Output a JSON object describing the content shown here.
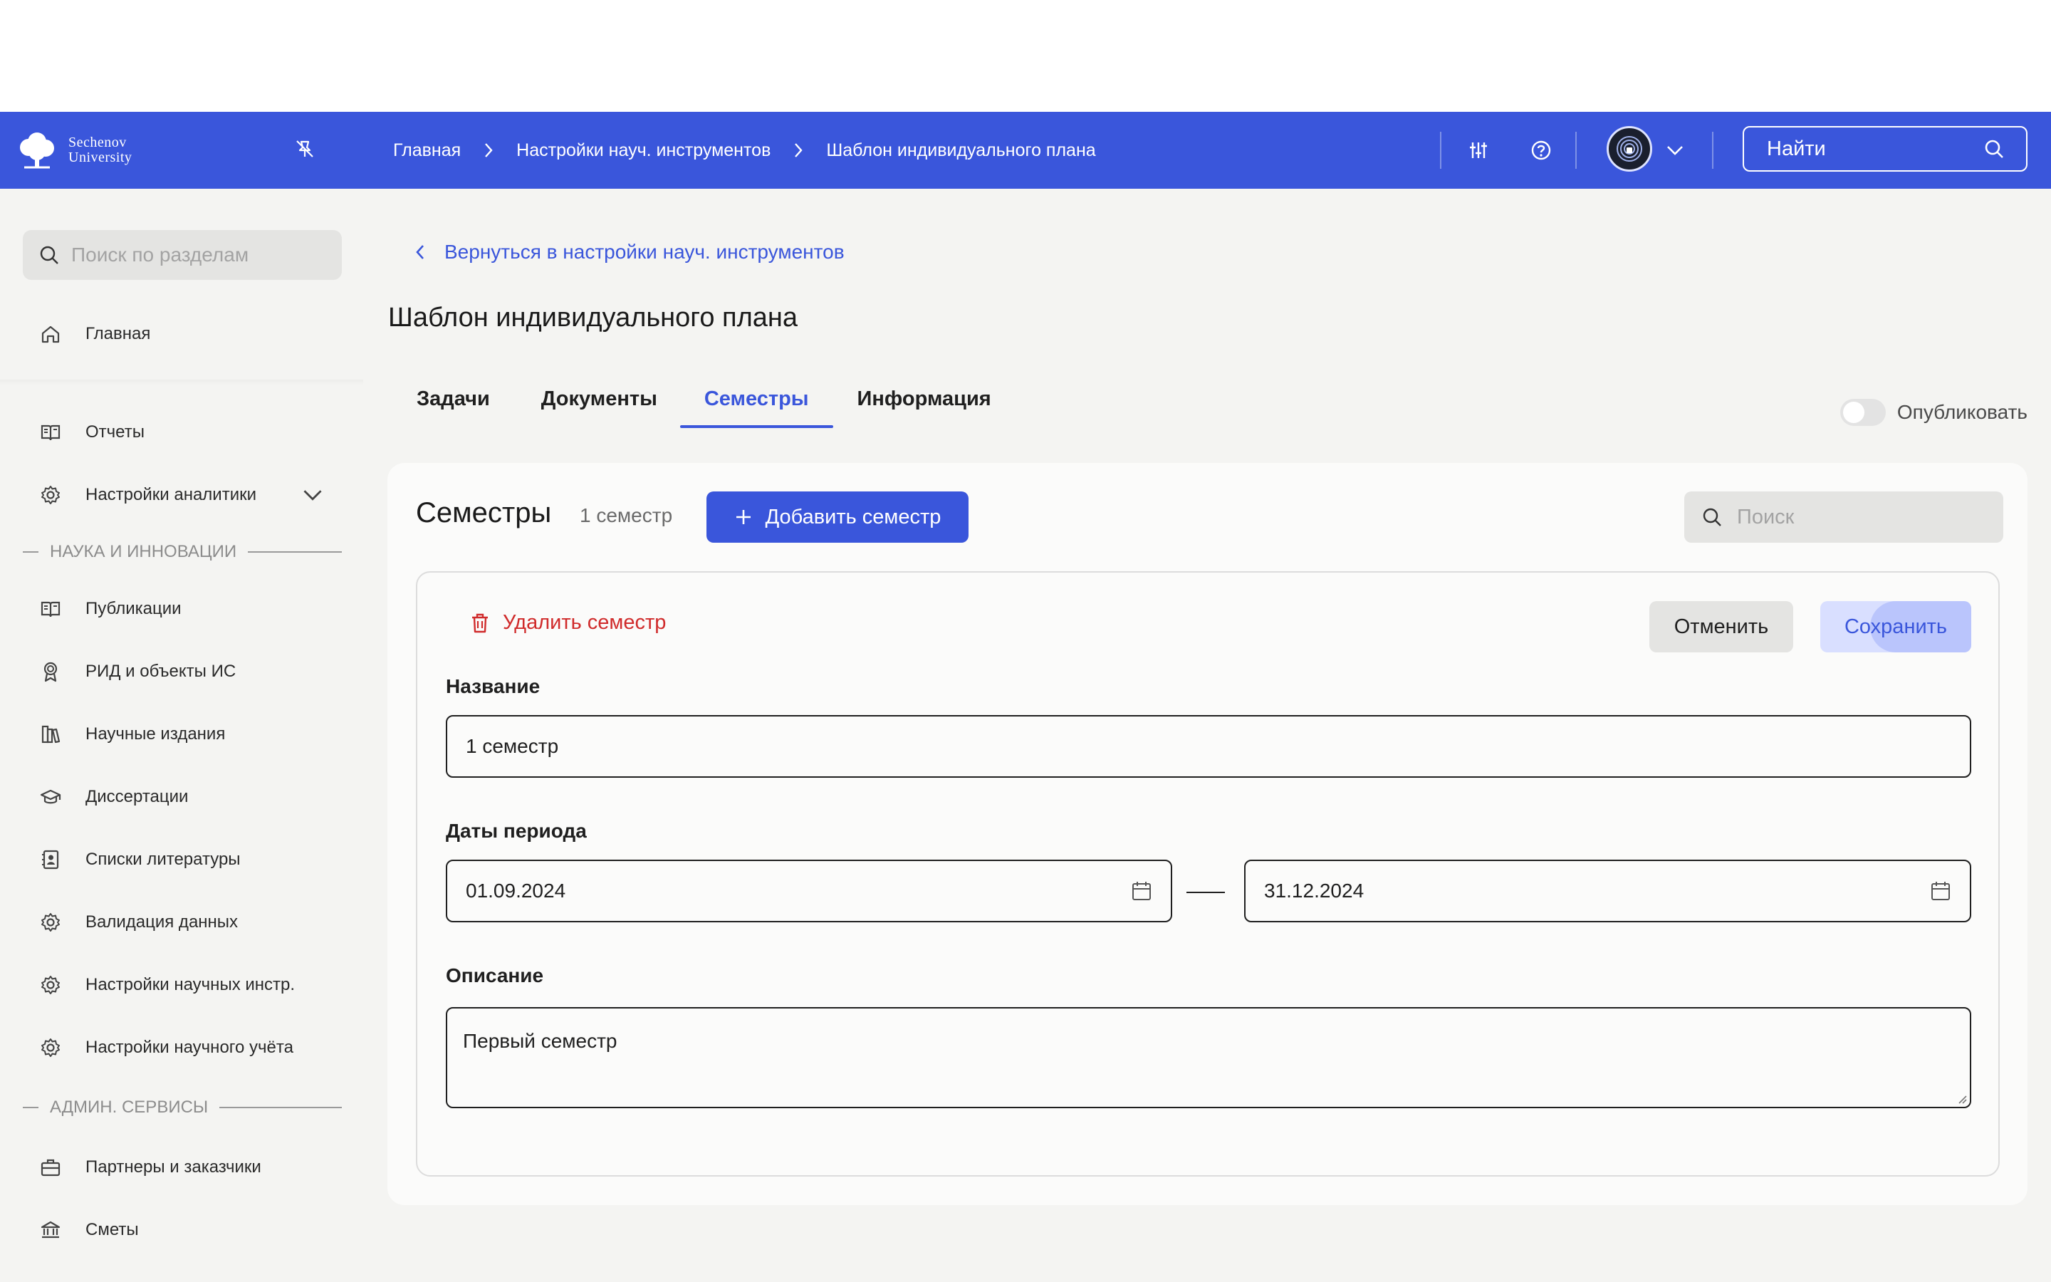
{
  "header": {
    "logo_line1": "Sechenov",
    "logo_line2": "University",
    "breadcrumbs": [
      "Главная",
      "Настройки науч. инструментов",
      "Шаблон индивидуального плана"
    ],
    "search_label": "Найти"
  },
  "sidebar": {
    "search_placeholder": "Поиск по разделам",
    "items_top": [
      {
        "label": "Главная",
        "icon": "home-icon"
      },
      {
        "label": "Отчеты",
        "icon": "book-icon"
      },
      {
        "label": "Настройки аналитики",
        "icon": "gear-icon"
      }
    ],
    "section_science": "НАУКА И ИННОВАЦИИ",
    "items_science": [
      {
        "label": "Публикации",
        "icon": "book-icon"
      },
      {
        "label": "РИД и объекты ИС",
        "icon": "award-icon"
      },
      {
        "label": "Научные издания",
        "icon": "library-icon"
      },
      {
        "label": "Диссертации",
        "icon": "graduation-cap-icon"
      },
      {
        "label": "Списки литературы",
        "icon": "contact-book-icon"
      },
      {
        "label": "Валидация данных",
        "icon": "gear-icon"
      },
      {
        "label": "Настройки научных инстр.",
        "icon": "gear-icon"
      },
      {
        "label": "Настройки научного учёта",
        "icon": "gear-icon"
      }
    ],
    "section_admin": "АДМИН. СЕРВИСЫ",
    "items_admin": [
      {
        "label": "Партнеры и заказчики",
        "icon": "briefcase-icon"
      },
      {
        "label": "Сметы",
        "icon": "bank-icon"
      }
    ]
  },
  "main": {
    "back_link": "Вернуться в настройки науч. инструментов",
    "title": "Шаблон индивидуального плана",
    "tabs": [
      "Задачи",
      "Документы",
      "Семестры",
      "Информация"
    ],
    "active_tab": "Семестры",
    "publish_label": "Опубликовать",
    "card": {
      "title": "Семестры",
      "count": "1 семестр",
      "add_button": "Добавить семестр",
      "search_placeholder": "Поиск",
      "form": {
        "delete_label": "Удалить семестр",
        "cancel_label": "Отменить",
        "save_label": "Сохранить",
        "name_label": "Название",
        "name_value": "1 семестр",
        "dates_label": "Даты периода",
        "date_from": "01.09.2024",
        "date_to": "31.12.2024",
        "description_label": "Описание",
        "description_value": "Первый семестр"
      }
    }
  },
  "colors": {
    "brand": "#3a56db",
    "danger": "#d02b2b",
    "background": "#f4f4f2"
  }
}
